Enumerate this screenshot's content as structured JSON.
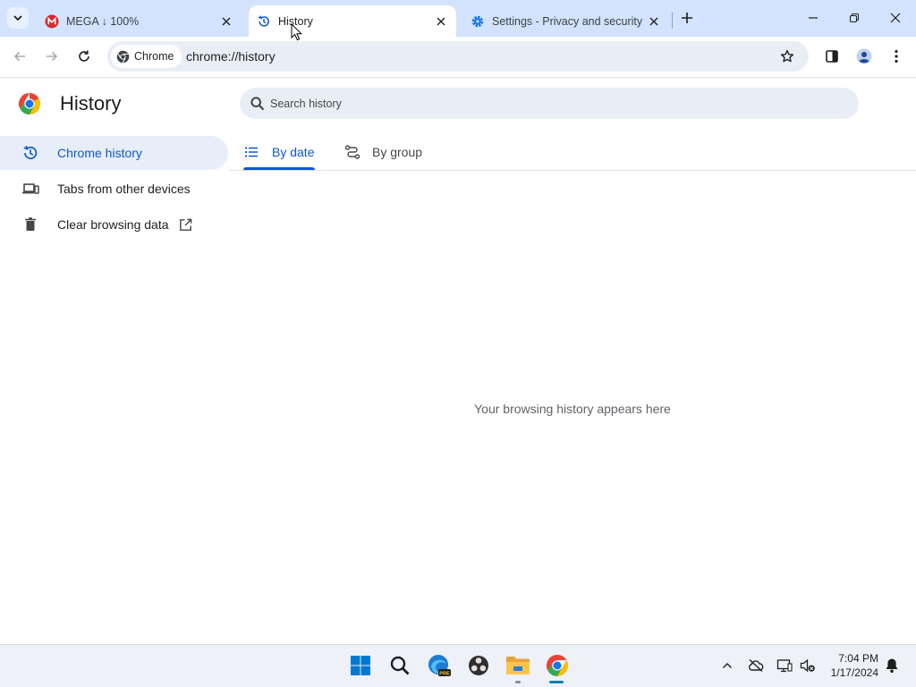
{
  "browser": {
    "tabs": [
      {
        "title": "MEGA ↓ 100%",
        "icon": "mega-icon"
      },
      {
        "title": "History",
        "icon": "history-icon",
        "active": true
      },
      {
        "title": "Settings - Privacy and security",
        "icon": "gear-icon"
      }
    ],
    "omnibox": {
      "chip_label": "Chrome",
      "url": "chrome://history"
    }
  },
  "page": {
    "title": "History",
    "search_placeholder": "Search history",
    "sidebar": [
      {
        "label": "Chrome history",
        "icon": "history-icon",
        "active": true
      },
      {
        "label": "Tabs from other devices",
        "icon": "devices-icon"
      },
      {
        "label": "Clear browsing data",
        "icon": "trash-icon",
        "external": true
      }
    ],
    "content_tabs": [
      {
        "label": "By date",
        "icon": "list-icon",
        "active": true
      },
      {
        "label": "By group",
        "icon": "route-icon"
      }
    ],
    "empty_message": "Your browsing history appears here"
  },
  "taskbar": {
    "time": "7:04 PM",
    "date": "1/17/2024",
    "apps": [
      "windows-start",
      "search",
      "edge-beta",
      "obs-studio",
      "file-explorer",
      "chrome"
    ],
    "edge_badge": "PRE"
  },
  "colors": {
    "accent": "#0b57d0",
    "tabstrip": "#d3e3fd",
    "omnibox": "#e9eef6",
    "active_sidebar": "#e8eef9"
  }
}
